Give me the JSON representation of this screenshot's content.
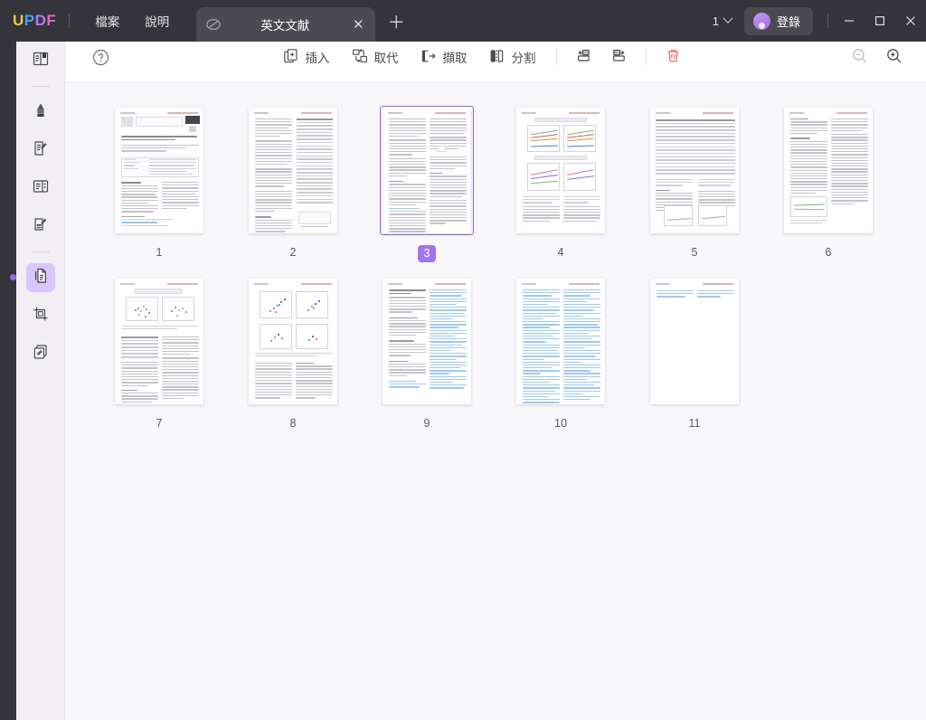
{
  "app": {
    "logo": "UPDF",
    "logo_letters": [
      "U",
      "P",
      "D",
      "F"
    ],
    "brand_colors": {
      "u": "#f5c842",
      "p": "#4d9ef6",
      "d": "#b47af0",
      "f": "#e069c9",
      "accent": "#9b6ae8",
      "accent_light": "#d9c6fb",
      "danger": "#e0483d"
    }
  },
  "menu": {
    "file": "檔案",
    "help": "說明"
  },
  "tab": {
    "title": "英文文献",
    "close": "✕",
    "new_tab": "＋"
  },
  "window": {
    "count": "1",
    "login_label": "登錄",
    "minimize": "—",
    "maximize": "□",
    "close": "✕"
  },
  "toolbar": {
    "help": "?",
    "insert": "插入",
    "replace": "取代",
    "extract": "擷取",
    "split": "分割",
    "rotate_left": "",
    "rotate_right": "",
    "delete": "",
    "zoom_out": "",
    "zoom_in": ""
  },
  "sidebar": {
    "items": [
      {
        "name": "reader",
        "icon": "book-reader-icon"
      },
      {
        "name": "annotate-highlight",
        "icon": "highlighter-icon"
      },
      {
        "name": "edit-pdf",
        "icon": "edit-document-icon"
      },
      {
        "name": "form",
        "icon": "form-layout-icon"
      },
      {
        "name": "edit-text",
        "icon": "edit-text-icon"
      },
      {
        "name": "organize-pages",
        "icon": "pages-icon",
        "active": true
      },
      {
        "name": "crop",
        "icon": "crop-icon"
      },
      {
        "name": "convert",
        "icon": "convert-icon"
      }
    ]
  },
  "pages": {
    "selected": 3,
    "items": [
      {
        "num": "1",
        "kind": "title"
      },
      {
        "num": "2",
        "kind": "text-table"
      },
      {
        "num": "3",
        "kind": "two-col"
      },
      {
        "num": "4",
        "kind": "charts"
      },
      {
        "num": "5",
        "kind": "table-plots"
      },
      {
        "num": "6",
        "kind": "two-col-plot"
      },
      {
        "num": "7",
        "kind": "scatter-table"
      },
      {
        "num": "8",
        "kind": "scatter-quad"
      },
      {
        "num": "9",
        "kind": "refs-start"
      },
      {
        "num": "10",
        "kind": "refs"
      },
      {
        "num": "11",
        "kind": "refs-end"
      }
    ]
  }
}
